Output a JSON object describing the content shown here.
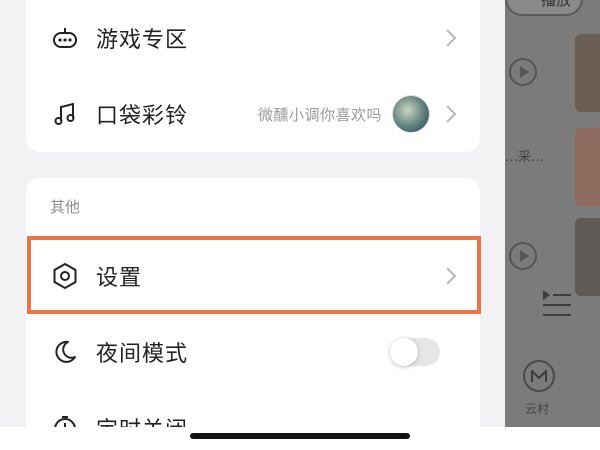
{
  "drawer": {
    "card1": {
      "items": [
        {
          "label": "游戏专区",
          "icon": "gamepad-icon"
        },
        {
          "label": "口袋彩铃",
          "icon": "music-note-icon",
          "sub": "微醺小调你喜欢吗"
        }
      ]
    },
    "card2": {
      "section_title": "其他",
      "items": [
        {
          "label": "设置",
          "icon": "settings-hexagon-icon",
          "highlighted": true
        },
        {
          "label": "夜间模式",
          "icon": "moon-icon",
          "toggle": false
        },
        {
          "label": "定时关闭",
          "icon": "timer-icon"
        }
      ]
    }
  },
  "background": {
    "play_button": "播放",
    "snippet": "…采…",
    "nav_label": "云村"
  },
  "colors": {
    "highlight": "#ef7246",
    "drawer_bg": "#f2f2f5",
    "card_bg": "#ffffff",
    "overlay": "#7b7b7b"
  }
}
